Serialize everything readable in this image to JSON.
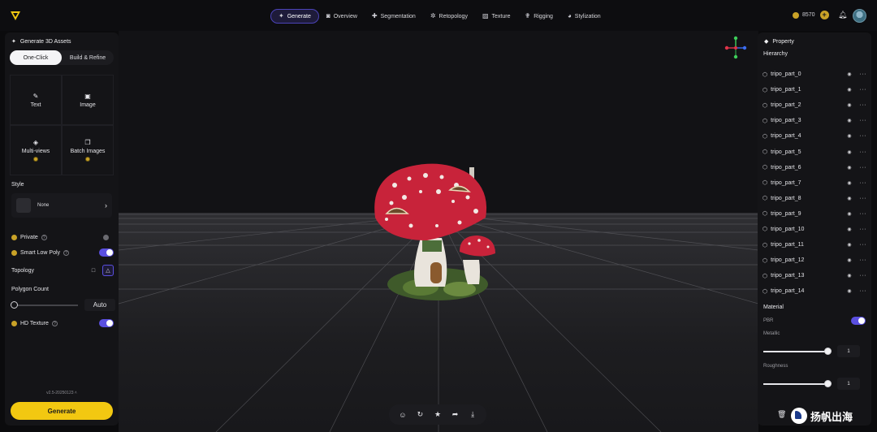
{
  "nav": {
    "items": [
      {
        "label": "Generate",
        "icon": "sparkle-icon",
        "active": true
      },
      {
        "label": "Overview",
        "icon": "camera-icon",
        "active": false
      },
      {
        "label": "Segmentation",
        "icon": "puzzle-icon",
        "active": false
      },
      {
        "label": "Retopology",
        "icon": "gear-icon",
        "active": false
      },
      {
        "label": "Texture",
        "icon": "hatch-icon",
        "active": false
      },
      {
        "label": "Rigging",
        "icon": "figure-icon",
        "active": false
      },
      {
        "label": "Stylization",
        "icon": "palette-icon",
        "active": false
      }
    ],
    "credits": "8570"
  },
  "left": {
    "title": "Generate 3D Assets",
    "tabs": {
      "one_click": "One-Click",
      "build_refine": "Build & Refine"
    },
    "inputs": [
      {
        "label": "Text",
        "icon": "pencil-icon"
      },
      {
        "label": "Image",
        "icon": "image-icon"
      },
      {
        "label": "Multi-views",
        "icon": "cube-views-icon"
      },
      {
        "label": "Batch Images",
        "icon": "images-icon"
      }
    ],
    "style_label": "Style",
    "style_value": "None",
    "private_label": "Private",
    "smart_low_poly_label": "Smart Low Poly",
    "topology_label": "Topology",
    "polygon_count_label": "Polygon Count",
    "polygon_count_value": "Auto",
    "hd_texture_label": "HD Texture",
    "version": "v2.5-20250123",
    "generate_label": "Generate"
  },
  "right": {
    "title": "Property",
    "hierarchy_label": "Hierarchy",
    "parts": [
      "tripo_part_0",
      "tripo_part_1",
      "tripo_part_2",
      "tripo_part_3",
      "tripo_part_4",
      "tripo_part_5",
      "tripo_part_6",
      "tripo_part_7",
      "tripo_part_8",
      "tripo_part_9",
      "tripo_part_10",
      "tripo_part_11",
      "tripo_part_12",
      "tripo_part_13",
      "tripo_part_14"
    ],
    "material_label": "Material",
    "pbr_label": "PBR",
    "metallic_label": "Metallic",
    "metallic_value": "1",
    "roughness_label": "Roughness",
    "roughness_value": "1"
  },
  "watermark": "扬帆出海",
  "colors": {
    "accent": "#5a4fe0",
    "generate": "#f2c811",
    "mushroom_cap": "#c8233a"
  }
}
